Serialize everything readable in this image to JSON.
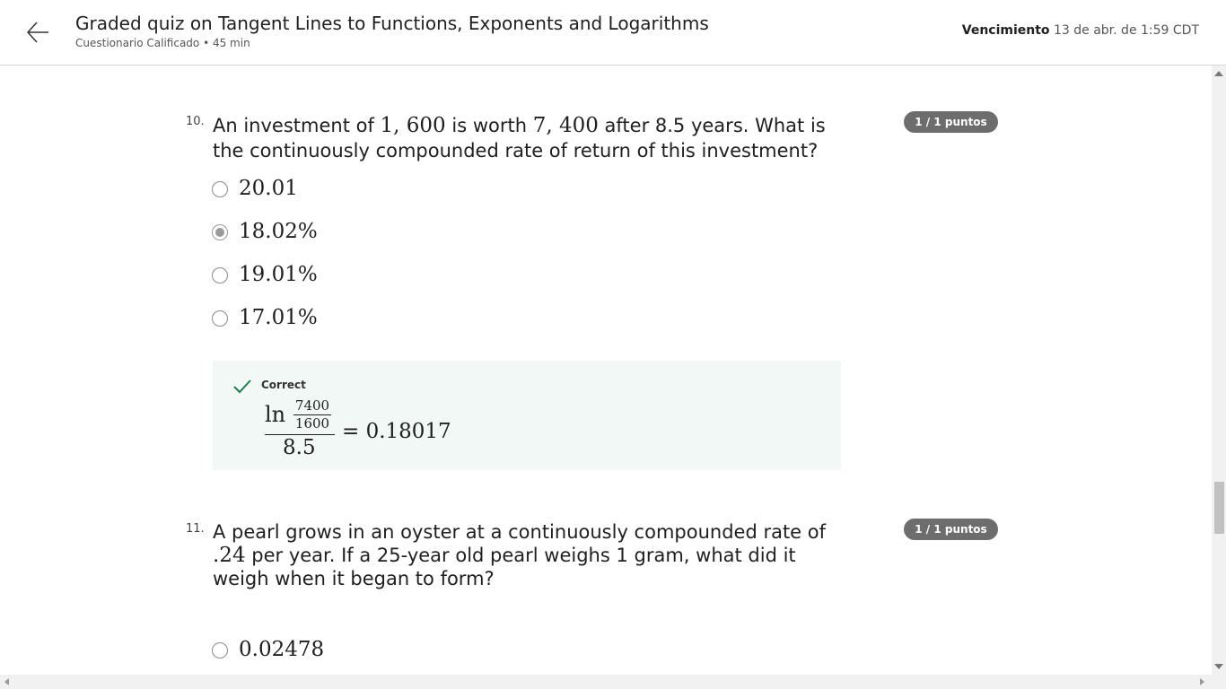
{
  "header": {
    "title": "Graded quiz on Tangent Lines to Functions, Exponents and Logarithms",
    "subtitle": "Cuestionario Calificado • 45 min",
    "due_label": "Vencimiento",
    "due_value": "13 de abr. de 1:59 CDT",
    "back_icon": "arrow-left-icon"
  },
  "questions": [
    {
      "number": "10.",
      "text_a": "An investment of ",
      "math_a": "1, 600",
      "text_b": " is worth ",
      "math_b": "7, 400",
      "text_c": " after 8.5 years. What is the continuously compounded rate of return of this investment?",
      "score": "1 / 1 puntos",
      "options": [
        "20.01",
        "18.02%",
        "19.01%",
        "17.01%"
      ],
      "selected_index": 1,
      "feedback": {
        "status": "Correct",
        "ln": "ln",
        "frac_top": "7400",
        "frac_bottom": "1600",
        "denominator": "8.5",
        "result": "= 0.18017"
      }
    },
    {
      "number": "11.",
      "text_a": "A pearl grows in an oyster at a continuously compounded rate of ",
      "math_a": ".24",
      "text_b": " per year. If a 25-year old pearl weighs 1 gram, what did it weigh when it began to form?",
      "score": "1 / 1 puntos",
      "options": [
        "0.02478"
      ]
    }
  ],
  "colors": {
    "badge": "#6d6d6d",
    "feedback_bg": "#f2f8f5",
    "check": "#1e7e4f"
  }
}
